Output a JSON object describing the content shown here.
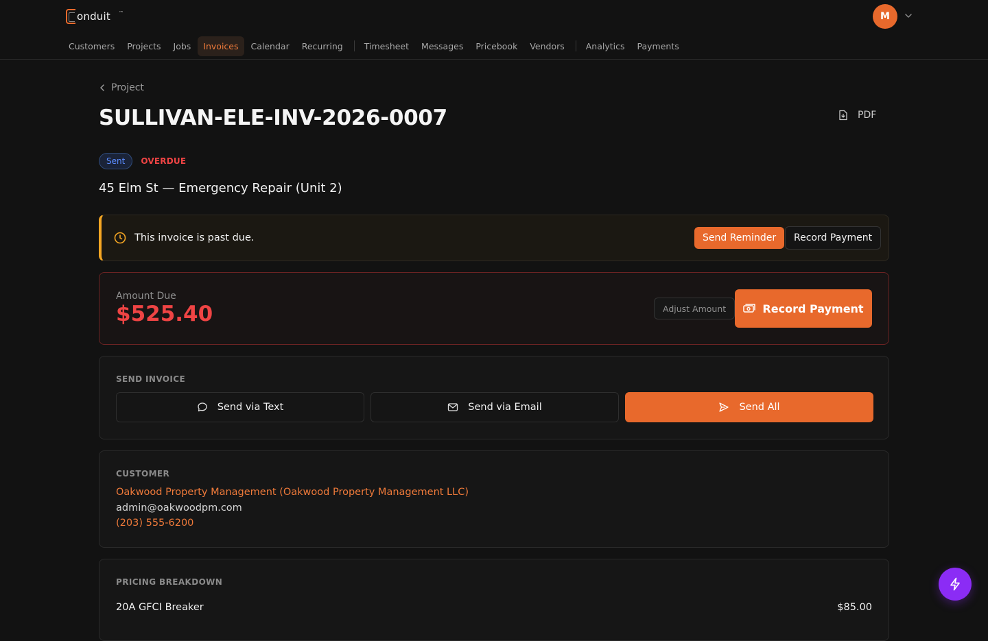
{
  "brand": {
    "name": "onduit",
    "tm": "™"
  },
  "user": {
    "initial": "M"
  },
  "nav": {
    "items": [
      "Customers",
      "Projects",
      "Jobs",
      "Invoices",
      "Calendar",
      "Recurring",
      "Timesheet",
      "Messages",
      "Pricebook",
      "Vendors",
      "Analytics",
      "Payments"
    ],
    "active": "Invoices"
  },
  "breadcrumb": {
    "back_label": "Project"
  },
  "invoice": {
    "number": "SULLIVAN-ELE-INV-2026-0007",
    "status": "Sent",
    "flag": "OVERDUE",
    "title": "45 Elm St — Emergency Repair (Unit 2)",
    "pdf_label": "PDF"
  },
  "alert": {
    "message": "This invoice is past due.",
    "send_reminder_label": "Send Reminder",
    "record_payment_label": "Record Payment"
  },
  "amount_due": {
    "label": "Amount Due",
    "value": "$525.40",
    "adjust_label": "Adjust Amount",
    "record_payment_label": "Record Payment"
  },
  "send_invoice": {
    "section_label": "SEND INVOICE",
    "text_label": "Send via Text",
    "email_label": "Send via Email",
    "all_label": "Send All"
  },
  "customer": {
    "section_label": "CUSTOMER",
    "name": "Oakwood Property Management (Oakwood Property Management LLC)",
    "email": "admin@oakwoodpm.com",
    "phone": "(203) 555-6200"
  },
  "pricing": {
    "section_label": "PRICING BREAKDOWN",
    "items": [
      {
        "name": "20A GFCI Breaker",
        "price": "$85.00"
      }
    ]
  },
  "colors": {
    "accent": "#e8692c",
    "danger": "#ef4444",
    "warning": "#f5a623",
    "info": "#5b8cff",
    "fab": "#8b2cf5"
  }
}
